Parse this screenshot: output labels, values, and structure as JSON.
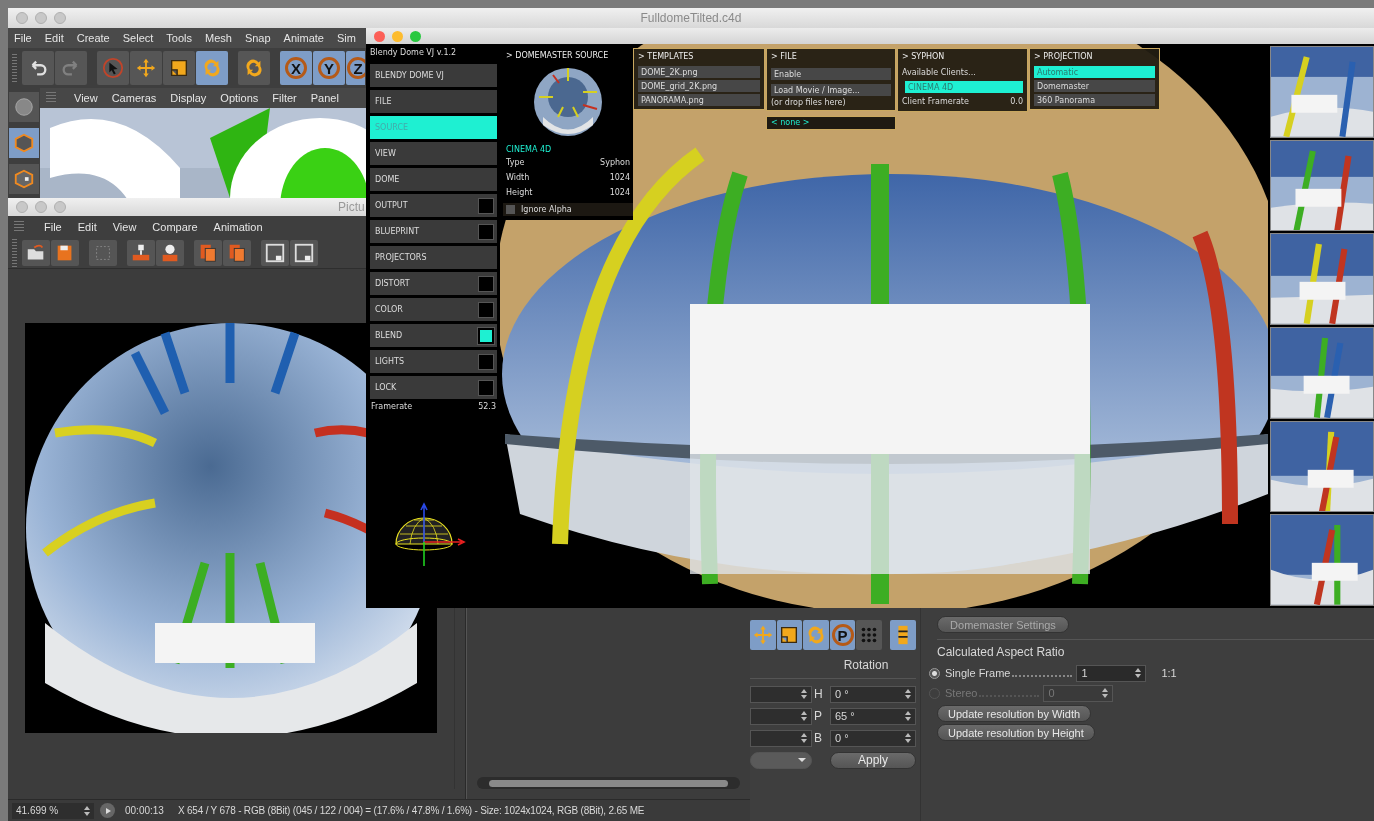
{
  "main_window": {
    "title": "FulldomeTilted.c4d",
    "menu": [
      "File",
      "Edit",
      "Create",
      "Select",
      "Tools",
      "Mesh",
      "Snap",
      "Animate",
      "Sim"
    ],
    "tools": [
      {
        "kind": "undo",
        "selected": false
      },
      {
        "kind": "redo",
        "selected": false
      },
      {
        "kind": "select",
        "selected": false
      },
      {
        "kind": "move",
        "selected": false
      },
      {
        "kind": "scale",
        "selected": false
      },
      {
        "kind": "rotate",
        "selected": true
      },
      {
        "kind": "rotate",
        "selected": false
      },
      {
        "kind": "letter",
        "label": "X",
        "selected": true
      },
      {
        "kind": "letter",
        "label": "Y",
        "selected": true
      },
      {
        "kind": "letter",
        "label": "Z",
        "selected": true
      }
    ],
    "viewport_menu": [
      "View",
      "Cameras",
      "Display",
      "Options",
      "Filter",
      "Panel"
    ],
    "coordinates": {
      "tools": [
        {
          "kind": "move",
          "selected": true
        },
        {
          "kind": "scale",
          "selected": true
        },
        {
          "kind": "rotate",
          "selected": true
        },
        {
          "kind": "letter",
          "label": "P",
          "selected": true
        },
        {
          "kind": "grid",
          "selected": false
        },
        {
          "kind": "film",
          "selected": true
        }
      ],
      "heading": "Rotation",
      "fields": [
        {
          "label": "H",
          "value": "0 °"
        },
        {
          "label": "P",
          "value": "65 °"
        },
        {
          "label": "B",
          "value": "0 °"
        }
      ],
      "apply": "Apply"
    },
    "attributes": {
      "tab": "Domemaster Settings",
      "section": "Calculated Aspect Ratio",
      "options": [
        {
          "label": "Single Frame",
          "value": "1",
          "selected": true,
          "disabled": false
        },
        {
          "label": "Stereo",
          "value": "0",
          "selected": false,
          "disabled": true
        }
      ],
      "ratio": "1:1",
      "buttons": [
        "Update resolution by Width",
        "Update resolution by Height"
      ]
    }
  },
  "picture_viewer": {
    "title": "Pictu",
    "menu": [
      "File",
      "Edit",
      "View",
      "Compare",
      "Animation"
    ],
    "status": {
      "zoom": "41.699 %",
      "time": "00:00:13",
      "info": "X 654 / Y 678 - RGB (8Bit) (045 / 122 / 004) = (17.6% / 47.8% / 1.6%) - Size: 1024x1024, RGB (8Bit), 2.65 ME"
    }
  },
  "blendy": {
    "version": "Blendy Dome VJ v.1.2",
    "menu": [
      {
        "label": "BLENDY DOME VJ",
        "kind": "plain",
        "selected": false
      },
      {
        "label": "FILE",
        "kind": "plain",
        "selected": false
      },
      {
        "label": "SOURCE",
        "kind": "plain",
        "selected": true
      },
      {
        "label": "VIEW",
        "kind": "plain",
        "selected": false
      },
      {
        "label": "DOME",
        "kind": "plain",
        "selected": false
      },
      {
        "label": "OUTPUT",
        "kind": "toggle",
        "selected": false,
        "on": false
      },
      {
        "label": "BLUEPRINT",
        "kind": "toggle",
        "selected": false,
        "on": false
      },
      {
        "label": "PROJECTORS",
        "kind": "plain",
        "selected": false
      },
      {
        "label": "DISTORT",
        "kind": "toggle",
        "selected": false,
        "on": false
      },
      {
        "label": "COLOR",
        "kind": "toggle",
        "selected": false,
        "on": false
      },
      {
        "label": "BLEND",
        "kind": "toggle",
        "selected": false,
        "on": true
      },
      {
        "label": "LIGHTS",
        "kind": "toggle",
        "selected": false,
        "on": false
      },
      {
        "label": "LOCK",
        "kind": "toggle",
        "selected": false,
        "on": false
      }
    ],
    "framerate_label": "Framerate",
    "framerate": "52.3",
    "source": {
      "heading": "> DOMEMASTER SOURCE",
      "name": "CINEMA 4D",
      "rows": [
        {
          "label": "Type",
          "value": "Syphon"
        },
        {
          "label": "Width",
          "value": "1024"
        },
        {
          "label": "Height",
          "value": "1024"
        }
      ],
      "ignore_alpha": {
        "label": "Ignore Alpha",
        "checked": false
      }
    },
    "templates": {
      "heading": "> TEMPLATES",
      "items": [
        "DOME_2K.png",
        "DOME_grid_2K.png",
        "PANORAMA.png"
      ]
    },
    "file": {
      "heading": "> FILE",
      "items": [
        "Enable",
        "Load Movie / Image..."
      ],
      "hint": "(or drop files here)",
      "current": "< none >"
    },
    "syphon": {
      "heading": "> SYPHON",
      "label": "Available Clients...",
      "clients": [
        {
          "label": "CINEMA 4D",
          "selected": true
        }
      ],
      "framerate_label": "Client Framerate",
      "framerate": "0.0"
    },
    "projection": {
      "heading": "> PROJECTION",
      "items": [
        {
          "label": "Automatic",
          "selected": true
        },
        {
          "label": "Domemaster",
          "selected": false
        },
        {
          "label": "360 Panorama",
          "selected": false
        }
      ]
    }
  }
}
